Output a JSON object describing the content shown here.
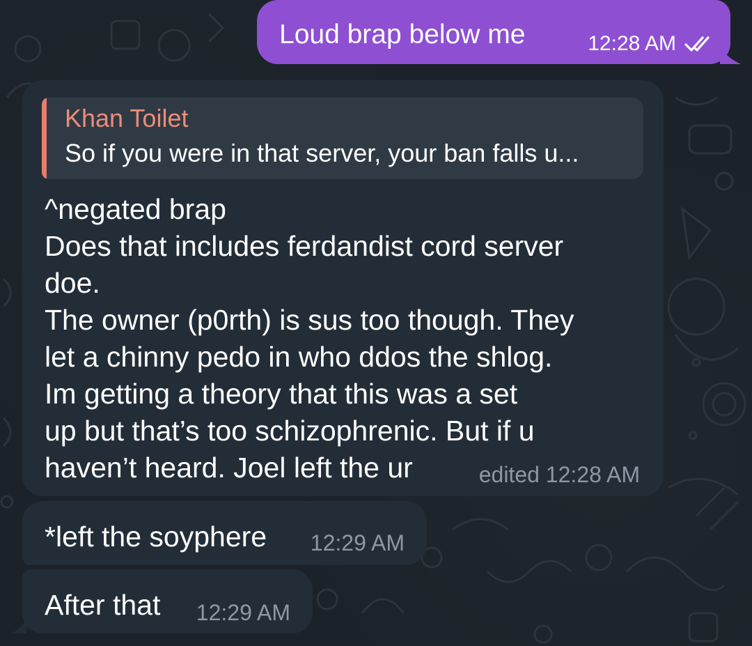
{
  "chat": {
    "messages": [
      {
        "direction": "outgoing",
        "text": "Loud brap below me",
        "time": "12:28 AM",
        "status_icon": "double-check-icon"
      },
      {
        "direction": "incoming",
        "reply": {
          "author": "Khan Toilet",
          "preview": "So if you were in that server, your ban falls u..."
        },
        "lines": [
          "^negated brap",
          "Does that includes ferdandist cord server",
          "doe.",
          "The owner (p0rth) is sus too though. They",
          "let a chinny pedo in who ddos the shlog.",
          "Im getting a theory that this was a set",
          "up but that’s too schizophrenic. But if u",
          "haven’t heard. Joel left the ur"
        ],
        "meta": "edited 12:28 AM"
      },
      {
        "direction": "incoming",
        "text": "*left the soyphere",
        "time": "12:29 AM"
      },
      {
        "direction": "incoming",
        "text": "After that",
        "time": "12:29 AM"
      }
    ]
  },
  "colors": {
    "background": "#1b2229",
    "outgoing_bubble": "#8e4fd3",
    "incoming_bubble": "#232d37",
    "reply_box": "#303a45",
    "reply_accent": "#e57e6c",
    "reply_author": "#ee8c78",
    "timestamp_incoming": "#8c98a5",
    "text": "#ffffff"
  }
}
